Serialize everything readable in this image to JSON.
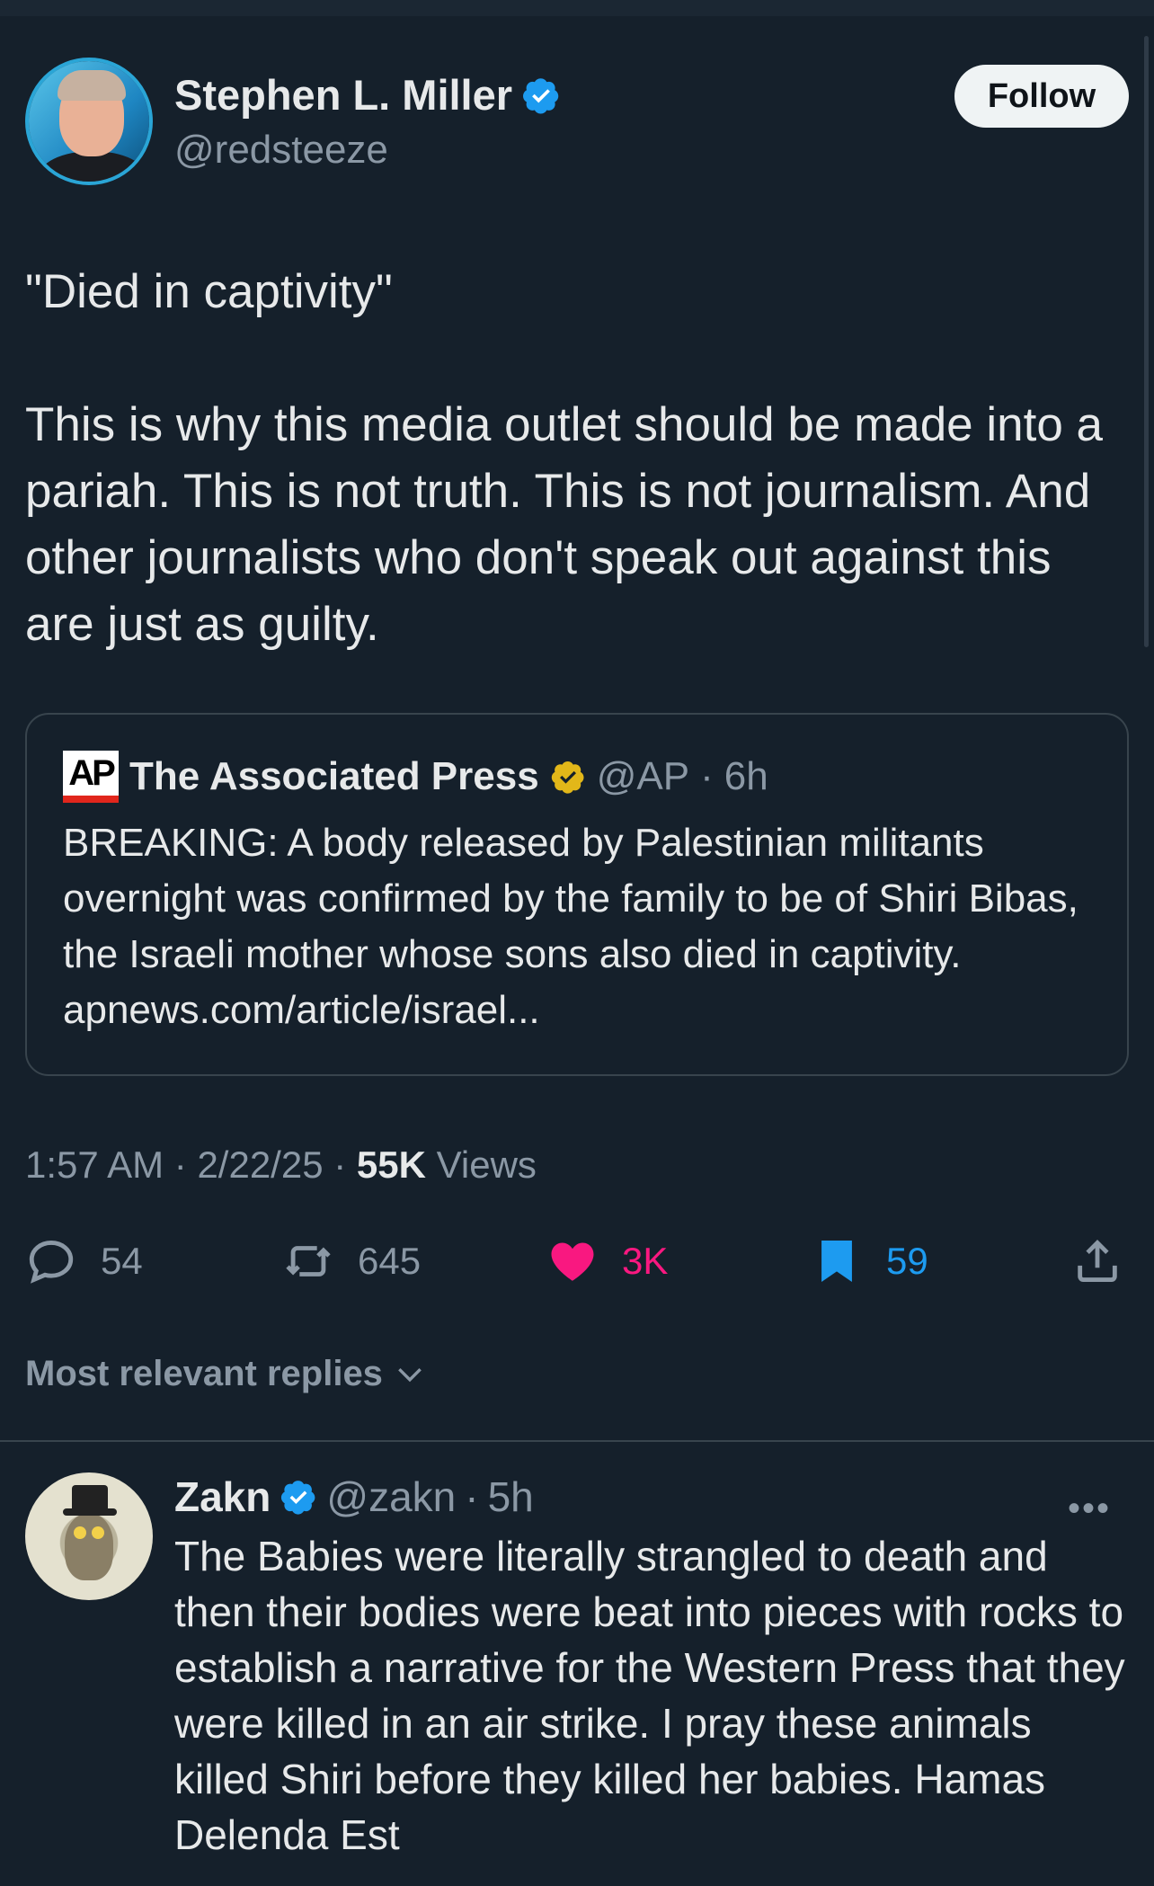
{
  "tweet": {
    "author_name": "Stephen L. Miller",
    "author_handle": "@redsteeze",
    "follow_label": "Follow",
    "text": "\"Died in captivity\"\n\nThis is why this media outlet should be made into a pariah. This is not truth. This is not journalism. And other journalists who don't speak out against this are just as guilty.",
    "time": "1:57 AM",
    "date": "2/22/25",
    "views_count": "55K",
    "views_label": "Views"
  },
  "quote": {
    "logo_text": "AP",
    "author_name": "The Associated Press",
    "author_handle": "@AP",
    "age": "6h",
    "text": "BREAKING: A body released by Palestinian militants overnight was confirmed by the family to be of Shiri Bibas, the Israeli mother whose sons also died in captivity. apnews.com/article/israel..."
  },
  "actions": {
    "replies": "54",
    "reposts": "645",
    "likes": "3K",
    "bookmarks": "59"
  },
  "replies_section": {
    "label": "Most relevant replies"
  },
  "reply": {
    "author_name": "Zakn",
    "author_handle": "@zakn",
    "age": "5h",
    "more_label": "•••",
    "text": "The Babies were literally strangled to death and then their bodies were beat into pieces with rocks to establish a narrative for the Western Press that they were killed in an air strike. I pray these animals killed Shiri before they killed her babies. Hamas Delenda Est"
  },
  "colors": {
    "background": "#15202b",
    "verified_blue": "#1d9bf0",
    "verified_gold": "#e2b719",
    "like_pink": "#f91880",
    "bookmark_blue": "#1d9bf0",
    "muted": "#8b98a5"
  }
}
